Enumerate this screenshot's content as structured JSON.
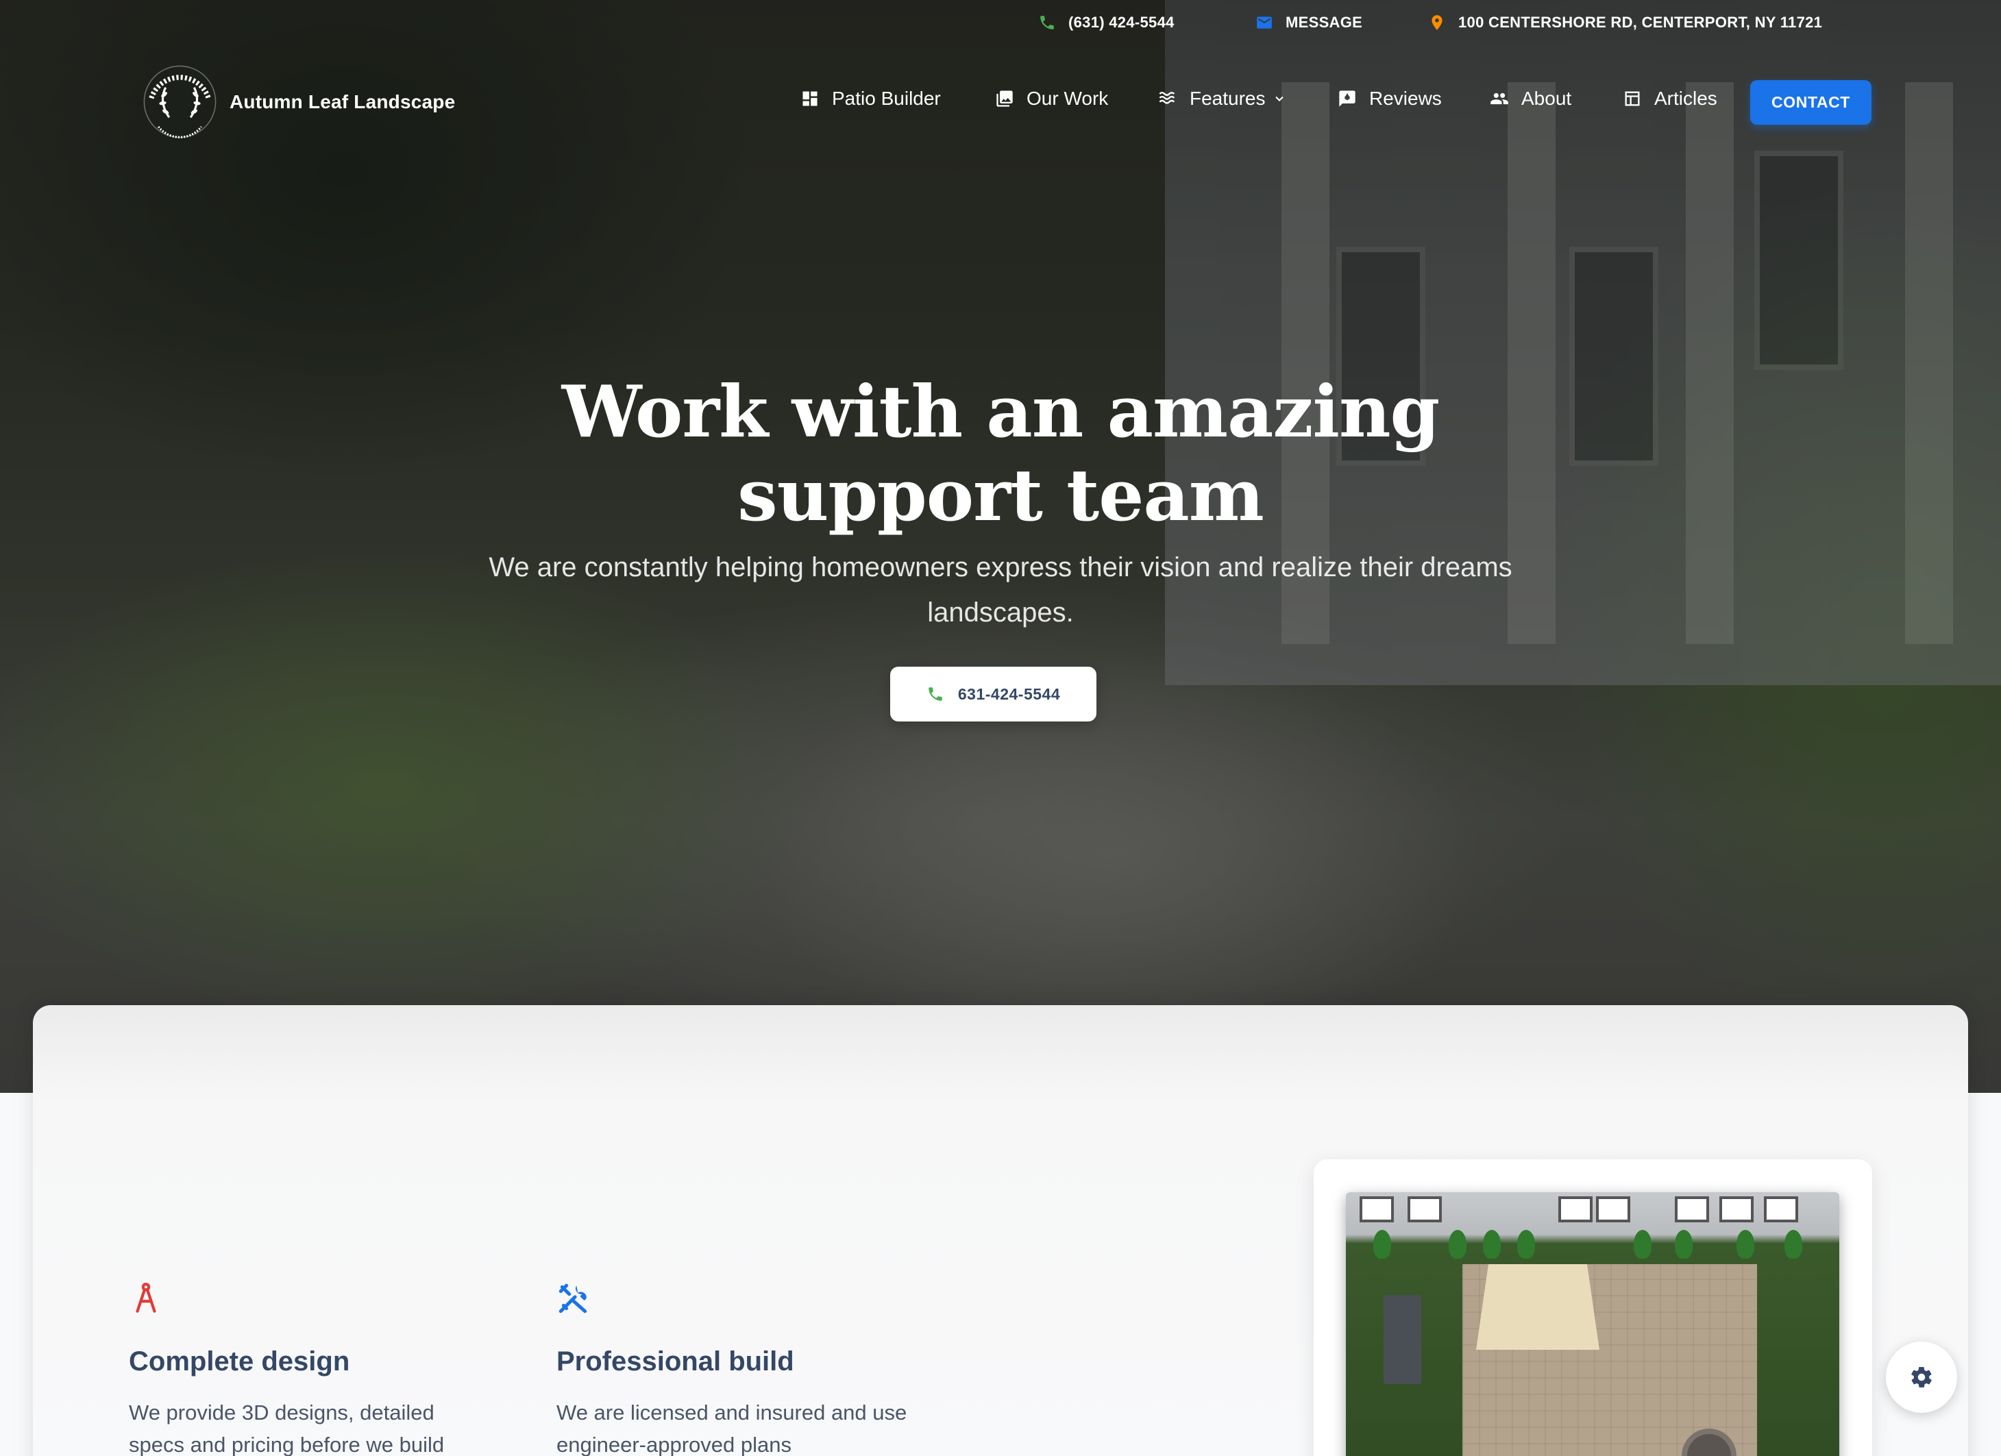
{
  "topbar": {
    "phone": "(631) 424-5544",
    "message": "MESSAGE",
    "address": "100 CENTERSHORE RD, CENTERPORT, NY 11721"
  },
  "brand": {
    "name": "Autumn Leaf Landscape"
  },
  "nav": {
    "items": [
      {
        "label": "Patio Builder",
        "icon": "dashboard-icon"
      },
      {
        "label": "Our Work",
        "icon": "photo-library-icon"
      },
      {
        "label": "Features",
        "icon": "waves-icon",
        "has_dropdown": true
      },
      {
        "label": "Reviews",
        "icon": "rate-review-icon"
      },
      {
        "label": "About",
        "icon": "people-icon"
      },
      {
        "label": "Articles",
        "icon": "article-icon"
      }
    ],
    "contact_label": "CONTACT"
  },
  "hero": {
    "title_line1": "Work with an amazing",
    "title_line2": "support team",
    "subtitle": "We are constantly helping homeowners express their vision and realize their dreams landscapes.",
    "call_label": "631-424-5544"
  },
  "features": [
    {
      "icon": "drafting-compass-icon",
      "title": "Complete design",
      "text": "We provide 3D designs, detailed specs and pricing before we build"
    },
    {
      "icon": "tools-icon",
      "title": "Professional build",
      "text": "We are licensed and insured and use engineer-approved plans"
    }
  ],
  "colors": {
    "accent": "#1a73e8",
    "phone_icon": "#4caf50",
    "pin_icon": "#fb8c00",
    "mail_icon": "#1a73e8",
    "compass_icon": "#e53935",
    "tools_icon": "#1a73e8",
    "heading": "#344767"
  }
}
